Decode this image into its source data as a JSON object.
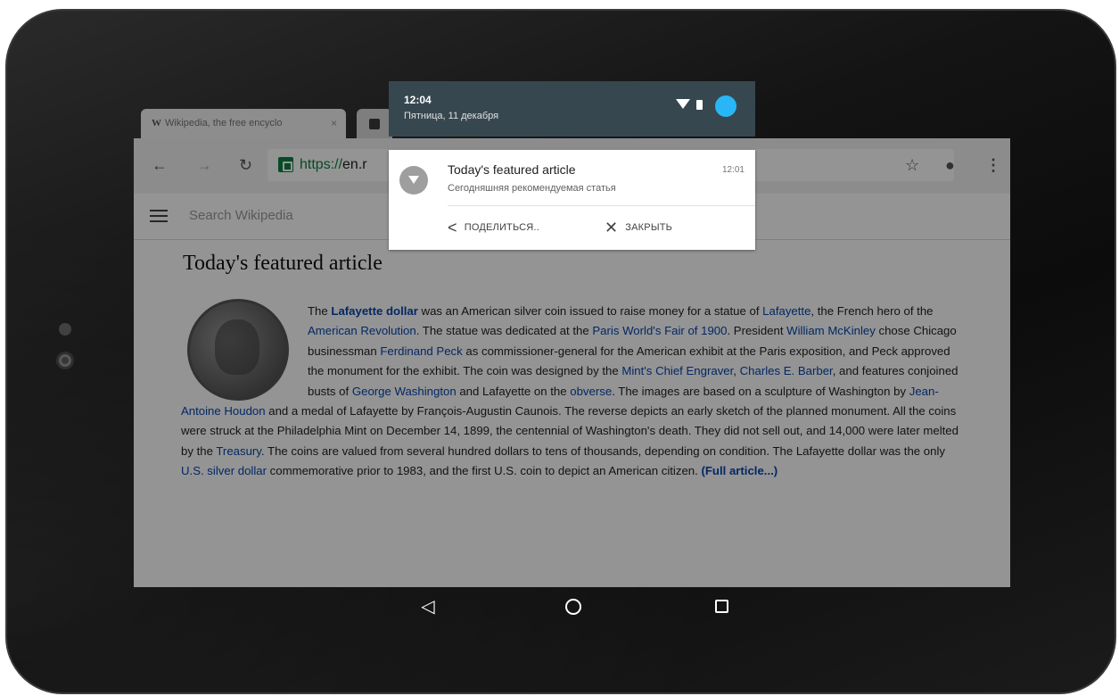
{
  "browser": {
    "tab_title": "Wikipedia, the free encyclo",
    "tab_close": "×",
    "url_scheme": "https://",
    "url_domain": "en.r",
    "wiki_search_placeholder": "Search Wikipedia"
  },
  "article": {
    "heading": "Today's featured article",
    "p1": "The ",
    "link_lafayette_dollar": "Lafayette dollar",
    "p2": " was an American silver coin issued to raise money for a statue of ",
    "link_lafayette": "Lafayette",
    "p3": ", the French hero of the ",
    "link_american_revolution": "American Revolution",
    "p4": ". The statue was dedicated at the ",
    "link_paris_fair": "Paris World's Fair of 1900",
    "p5": ". President ",
    "link_mckinley": "William McKinley",
    "p6": " chose Chicago businessman ",
    "link_peck": "Ferdinand Peck",
    "p7": " as commissioner-general for the American exhibit at the Paris exposition, and Peck approved the monument for the exhibit. The coin was designed by the ",
    "link_mint": "Mint's Chief Engraver",
    "p8": ", ",
    "link_barber": "Charles E. Barber",
    "p9": ", and features conjoined busts of ",
    "link_washington": "George Washington",
    "p10": " and Lafayette on the ",
    "link_obverse": "obverse",
    "p11": ". The images are based on a sculpture of Washington by ",
    "link_houdon": "Jean-Antoine Houdon",
    "p12": " and a medal of Lafayette by François-Augustin Caunois. The reverse depicts an early sketch of the planned monument. All the coins were struck at the Philadelphia Mint on December 14, 1899, the centennial of Washington's death. They did not sell out, and 14,000 were later melted by the ",
    "link_treasury": "Treasury",
    "p13": ". The coins are valued from several hundred dollars to tens of thousands, depending on condition. The Lafayette dollar was the only ",
    "link_silver_dollar": "U.S. silver dollar",
    "p14": " commemorative prior to 1983, and the first U.S. coin to depict an American citizen. ",
    "link_full": "(Full article...)"
  },
  "status": {
    "time": "12:04",
    "date": "Пятница, 11 декабря"
  },
  "notification": {
    "title": "Today's featured article",
    "time": "12:01",
    "text": "Сегодняшняя рекомендуемая статья",
    "share_label": "ПОДЕЛИТЬСЯ..",
    "close_label": "ЗАКРЫТЬ"
  },
  "nav": {
    "back_glyph": "◁"
  },
  "colors": {
    "status_bar": "#37474f",
    "avatar": "#29b6f6",
    "link": "#0645ad",
    "secure": "#0b8043"
  },
  "icons": [
    "back-arrow-icon",
    "forward-arrow-icon",
    "reload-icon",
    "lock-icon",
    "star-icon",
    "mic-icon",
    "menu-icon",
    "hamburger-icon",
    "wifi-icon",
    "battery-icon",
    "share-icon",
    "close-icon",
    "nav-back-icon",
    "nav-home-icon",
    "nav-recents-icon"
  ]
}
